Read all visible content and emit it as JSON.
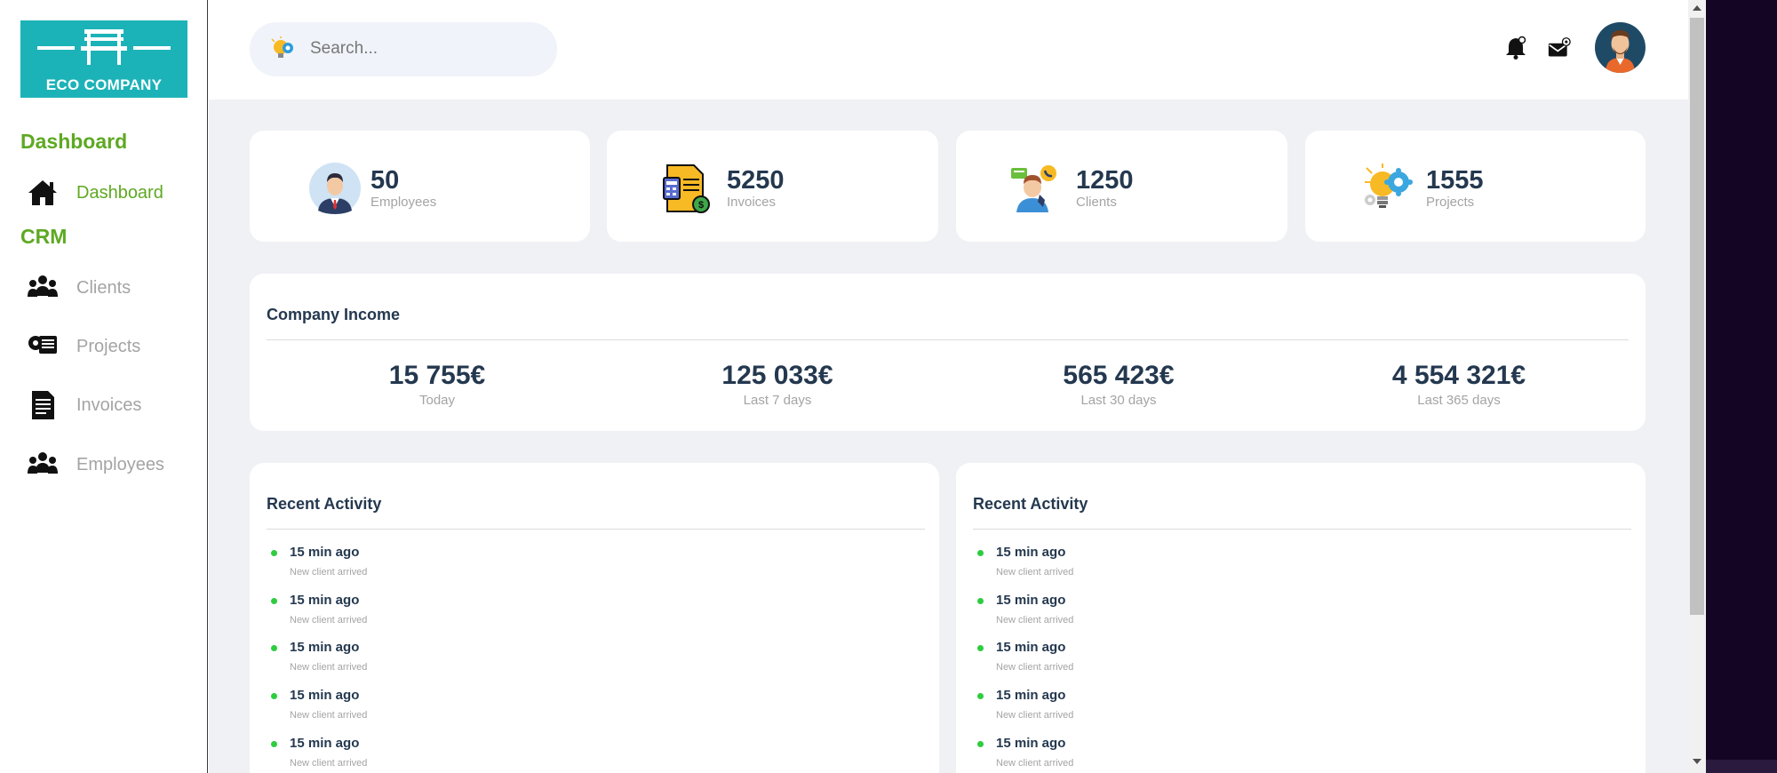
{
  "brand": {
    "name": "ECO COMPANY",
    "color": "#1cb3b8"
  },
  "sidebar": {
    "sections": [
      {
        "title": "Dashboard"
      },
      {
        "title": "CRM"
      }
    ],
    "items": [
      {
        "label": "Dashboard",
        "icon": "home-icon",
        "active": true
      },
      {
        "label": "Clients",
        "icon": "users-icon"
      },
      {
        "label": "Projects",
        "icon": "projects-icon"
      },
      {
        "label": "Invoices",
        "icon": "invoice-icon"
      },
      {
        "label": "Employees",
        "icon": "users-icon"
      }
    ]
  },
  "topbar": {
    "search": {
      "placeholder": "Search...",
      "value": ""
    },
    "icons": [
      "bell-icon",
      "mail-icon",
      "avatar"
    ]
  },
  "stats": [
    {
      "value": "50",
      "label": "Employees",
      "icon": "employee-icon"
    },
    {
      "value": "5250",
      "label": "Invoices",
      "icon": "invoice-doc-icon"
    },
    {
      "value": "1250",
      "label": "Clients",
      "icon": "client-icon"
    },
    {
      "value": "1555",
      "label": "Projects",
      "icon": "lightbulb-gear-icon"
    }
  ],
  "income": {
    "title": "Company Income",
    "items": [
      {
        "amount": "15 755€",
        "period": "Today"
      },
      {
        "amount": "125 033€",
        "period": "Last 7 days"
      },
      {
        "amount": "565 423€",
        "period": "Last 30 days"
      },
      {
        "amount": "4 554 321€",
        "period": "Last 365 days"
      }
    ]
  },
  "activity_left": {
    "title": "Recent Activity",
    "items": [
      {
        "time": "15 min ago",
        "desc": "New client arrived"
      },
      {
        "time": "15 min ago",
        "desc": "New client arrived"
      },
      {
        "time": "15 min ago",
        "desc": "New client arrived"
      },
      {
        "time": "15 min ago",
        "desc": "New client arrived"
      },
      {
        "time": "15 min ago",
        "desc": "New client arrived"
      }
    ]
  },
  "activity_right": {
    "title": "Recent Activity",
    "items": [
      {
        "time": "15 min ago",
        "desc": "New client arrived"
      },
      {
        "time": "15 min ago",
        "desc": "New client arrived"
      },
      {
        "time": "15 min ago",
        "desc": "New client arrived"
      },
      {
        "time": "15 min ago",
        "desc": "New client arrived"
      },
      {
        "time": "15 min ago",
        "desc": "New client arrived"
      }
    ]
  },
  "colors": {
    "accent_green": "#5ea923",
    "text_dark": "#24384f",
    "text_muted": "#a4a4a4",
    "background": "#f0f1f5",
    "activity_dot": "#2ecc40"
  }
}
